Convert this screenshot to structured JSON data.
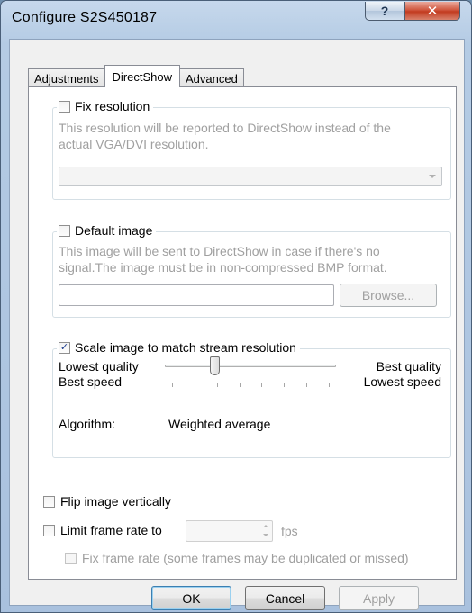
{
  "window": {
    "title": "Configure S2S450187",
    "help_label": "?",
    "close_label": "✕"
  },
  "tabs": [
    {
      "label": "Adjustments",
      "active": false
    },
    {
      "label": "DirectShow",
      "active": true
    },
    {
      "label": "Advanced",
      "active": false
    }
  ],
  "fix_resolution": {
    "label": "Fix resolution",
    "checked": false,
    "description_line1": "This resolution will be reported to DirectShow instead of the",
    "description_line2": "actual VGA/DVI resolution.",
    "dropdown_value": ""
  },
  "default_image": {
    "label": "Default image",
    "checked": false,
    "description_line1": "This image will be sent to DirectShow in case if there's no",
    "description_line2": "signal.The image must be in non-compressed BMP format.",
    "path_value": "",
    "browse_label": "Browse..."
  },
  "scale": {
    "label": "Scale image to match stream resolution",
    "checked": true,
    "checkmark": "✓",
    "left_label_top": "Lowest quality",
    "left_label_bottom": "Best speed",
    "right_label_top": "Best quality",
    "right_label_bottom": "Lowest speed",
    "slider_level": 0.28,
    "tick_count": 8,
    "algorithm_label": "Algorithm:",
    "algorithm_value": "Weighted average"
  },
  "flip": {
    "label": "Flip image vertically",
    "checked": false
  },
  "limit_frame_rate": {
    "label": "Limit frame rate to",
    "checked": false,
    "value": "",
    "unit": "fps"
  },
  "fix_frame_rate": {
    "label": "Fix frame rate (some frames may be duplicated or missed)",
    "checked": false
  },
  "buttons": {
    "ok": "OK",
    "cancel": "Cancel",
    "apply": "Apply"
  },
  "colors": {
    "title_bar": "#b4cbe4",
    "close_button": "#c23b1f",
    "checkmark": "#1c3c8e"
  }
}
